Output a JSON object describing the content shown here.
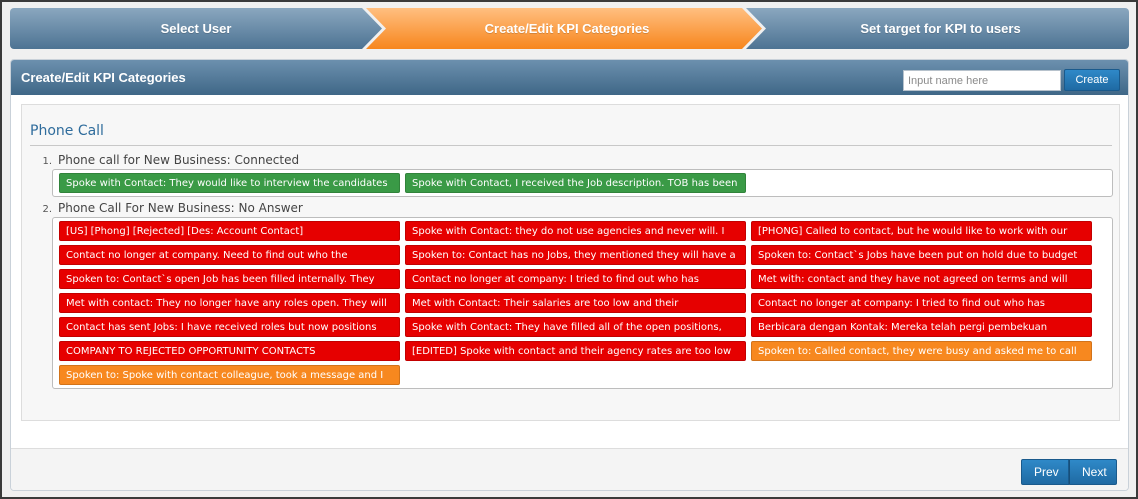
{
  "wizard": {
    "steps": [
      {
        "label": "Select User"
      },
      {
        "label": "Create/Edit KPI Categories"
      },
      {
        "label": "Set target for KPI to users"
      }
    ]
  },
  "panel": {
    "title": "Create/Edit KPI Categories",
    "name_input_placeholder": "Input name here",
    "create_label": "Create"
  },
  "category": {
    "title": "Phone Call",
    "subcategories": [
      {
        "number": "1.",
        "title": "Phone call for New Business: Connected",
        "tags": [
          {
            "label": "Spoke with Contact: They would like to interview the candidates",
            "color": "#3a9a46"
          },
          {
            "label": "Spoke with Contact, I received the Job description. TOB has been",
            "color": "#3a9a46"
          }
        ]
      },
      {
        "number": "2.",
        "title": "Phone Call For New Business: No Answer",
        "tags": [
          {
            "label": "[US] [Phong] [Rejected] [Des: Account Contact]",
            "color": "#e60000"
          },
          {
            "label": "Spoke with Contact: they do not use agencies and never will. I",
            "color": "#e60000"
          },
          {
            "label": "[PHONG] Called to contact, but he would like to work with our",
            "color": "#e60000"
          },
          {
            "label": "Contact no longer at company. Need to find out who the",
            "color": "#e60000"
          },
          {
            "label": "Spoken to: Contact has no Jobs, they mentioned they will have a",
            "color": "#e60000"
          },
          {
            "label": "Spoken to: Contact`s Jobs have been put on hold due to budget",
            "color": "#e60000"
          },
          {
            "label": "Spoken to: Contact`s open Job has been filled internally. They",
            "color": "#e60000"
          },
          {
            "label": "Contact no longer at company: I tried to find out who has",
            "color": "#e60000"
          },
          {
            "label": "Met with: contact and they have not agreed on terms and will",
            "color": "#e60000"
          },
          {
            "label": "Met with contact: They no longer have any roles open. They will",
            "color": "#e60000"
          },
          {
            "label": "Met with Contact: Their salaries are too low and their",
            "color": "#e60000"
          },
          {
            "label": "Contact no longer at company: I tried to find out who has",
            "color": "#e60000"
          },
          {
            "label": "Contact has sent Jobs: I have received roles but now positions",
            "color": "#e60000"
          },
          {
            "label": "Spoke with Contact: They have filled all of the open positions,",
            "color": "#e60000"
          },
          {
            "label": "Berbicara dengan Kontak: Mereka telah pergi pembekuan",
            "color": "#e60000"
          },
          {
            "label": "COMPANY TO REJECTED OPPORTUNITY CONTACTS",
            "color": "#e60000"
          },
          {
            "label": "[EDITED] Spoke with contact and their agency rates are too low",
            "color": "#e60000"
          },
          {
            "label": "Spoken to: Called contact, they were busy and asked me to call",
            "color": "#f7881f"
          },
          {
            "label": "Spoken to: Spoke with contact colleague, took a message and I",
            "color": "#f7881f"
          }
        ]
      }
    ]
  },
  "footer": {
    "prev_label": "Prev",
    "next_label": "Next"
  }
}
